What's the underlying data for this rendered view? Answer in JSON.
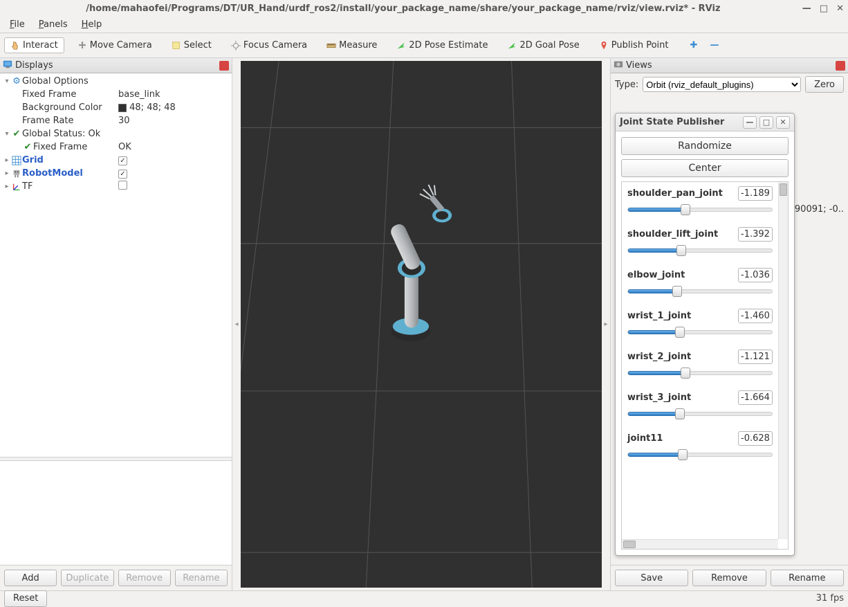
{
  "window": {
    "title": "/home/mahaofei/Programs/DT/UR_Hand/urdf_ros2/install/your_package_name/share/your_package_name/rviz/view.rviz* - RViz"
  },
  "menubar": {
    "file": "File",
    "panels": "Panels",
    "help": "Help"
  },
  "toolbar": {
    "interact": "Interact",
    "move_camera": "Move Camera",
    "select": "Select",
    "focus_camera": "Focus Camera",
    "measure": "Measure",
    "pose_estimate": "2D Pose Estimate",
    "goal_pose": "2D Goal Pose",
    "publish_point": "Publish Point"
  },
  "displays": {
    "panel_title": "Displays",
    "global_options": "Global Options",
    "fixed_frame": "Fixed Frame",
    "fixed_frame_value": "base_link",
    "background_color": "Background Color",
    "background_color_value": "48; 48; 48",
    "frame_rate": "Frame Rate",
    "frame_rate_value": "30",
    "global_status": "Global Status: Ok",
    "fixed_frame_status": "Fixed Frame",
    "fixed_frame_status_value": "OK",
    "grid": "Grid",
    "robot_model": "RobotModel",
    "tf": "TF",
    "buttons": {
      "add": "Add",
      "duplicate": "Duplicate",
      "remove": "Remove",
      "rename": "Rename"
    }
  },
  "views": {
    "panel_title": "Views",
    "type_label": "Type:",
    "type_value": "Orbit (rviz_default_plugins)",
    "zero": "Zero",
    "current_view_row": "90091; -0..",
    "buttons": {
      "save": "Save",
      "remove": "Remove",
      "rename": "Rename"
    }
  },
  "joint_publisher": {
    "title": "Joint State Publisher",
    "randomize": "Randomize",
    "center": "Center",
    "joints": [
      {
        "name": "shoulder_pan_joint",
        "value": "-1.189",
        "fill": 40
      },
      {
        "name": "shoulder_lift_joint",
        "value": "-1.392",
        "fill": 37
      },
      {
        "name": "elbow_joint",
        "value": "-1.036",
        "fill": 34
      },
      {
        "name": "wrist_1_joint",
        "value": "-1.460",
        "fill": 36
      },
      {
        "name": "wrist_2_joint",
        "value": "-1.121",
        "fill": 40
      },
      {
        "name": "wrist_3_joint",
        "value": "-1.664",
        "fill": 36
      },
      {
        "name": "joint11",
        "value": "-0.628",
        "fill": 38
      }
    ]
  },
  "statusbar": {
    "reset": "Reset",
    "fps": "31 fps"
  },
  "center": {
    "collapse_left": "◂",
    "collapse_right": "▸"
  }
}
